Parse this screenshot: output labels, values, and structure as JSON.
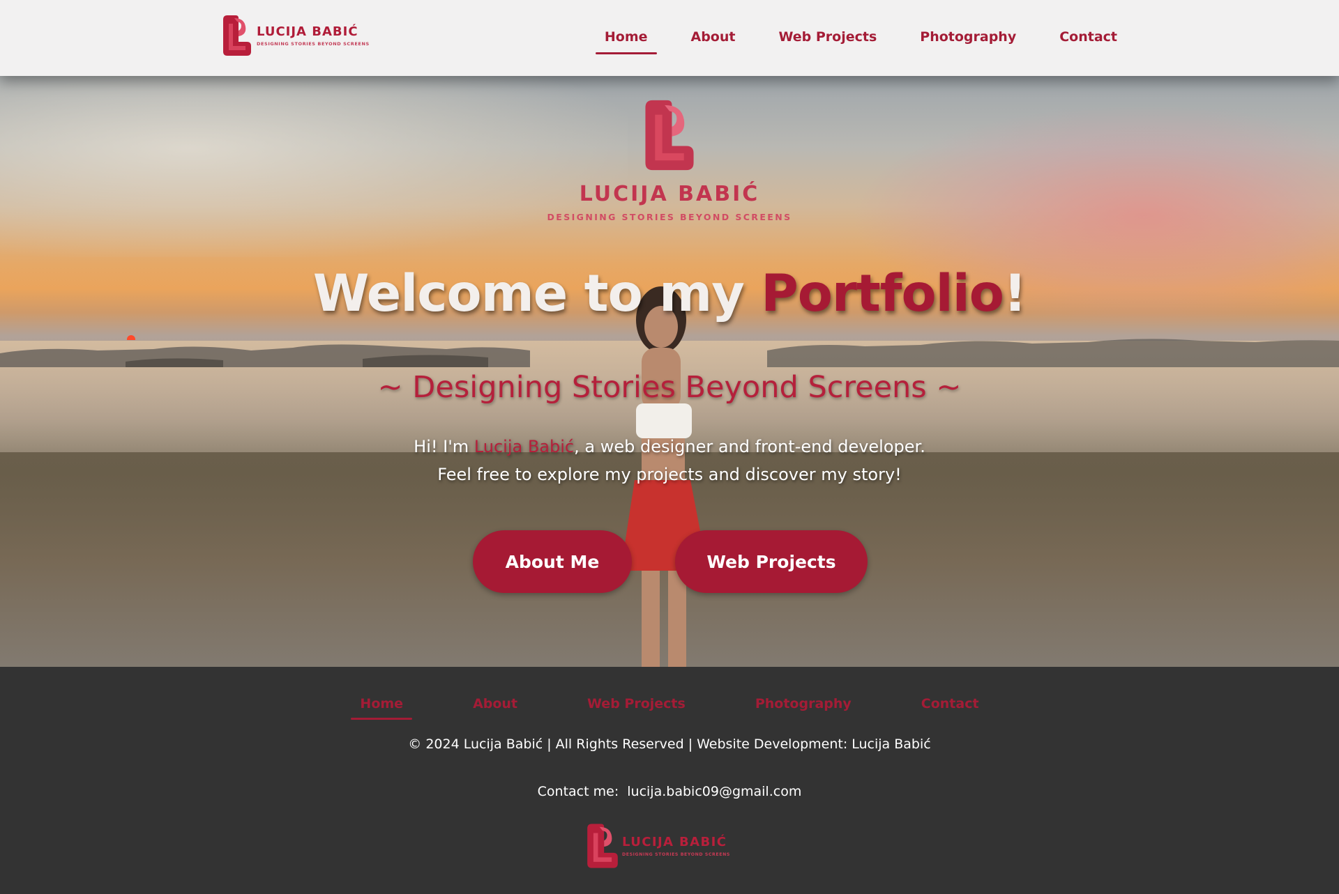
{
  "brand": {
    "name": "LUCIJA BABIĆ",
    "tagline": "DESIGNING STORIES BEYOND SCREENS"
  },
  "nav": {
    "items": [
      {
        "label": "Home",
        "active": true
      },
      {
        "label": "About"
      },
      {
        "label": "Web Projects"
      },
      {
        "label": "Photography"
      },
      {
        "label": "Contact"
      }
    ]
  },
  "hero": {
    "title_part1": "Welcome to my ",
    "title_accent": "Portfolio",
    "title_end": "!",
    "subtitle": "~ Designing Stories Beyond Screens ~",
    "intro_prefix": "Hi! I'm ",
    "intro_name": "Lucija Babić",
    "intro_suffix": ", a web designer and front-end developer.",
    "intro_line2": "Feel free to explore my projects and discover my story!",
    "buttons": {
      "about": "About Me",
      "projects": "Web Projects"
    }
  },
  "footer": {
    "nav": [
      {
        "label": "Home",
        "active": true
      },
      {
        "label": "About"
      },
      {
        "label": "Web Projects"
      },
      {
        "label": "Photography"
      },
      {
        "label": "Contact"
      }
    ],
    "copyright": "© 2024 Lucija Babić | All Rights Reserved | Website Development: Lucija Babić",
    "contact_label": "Contact me:",
    "contact_email": "lucija.babic09@gmail.com"
  },
  "colors": {
    "accent": "#a61a34",
    "logo_red": "#c2354f",
    "topbar_bg": "#f2f1f1",
    "footer_bg": "#333333"
  },
  "icons": {
    "logo_mark": "lb-monogram-icon"
  }
}
